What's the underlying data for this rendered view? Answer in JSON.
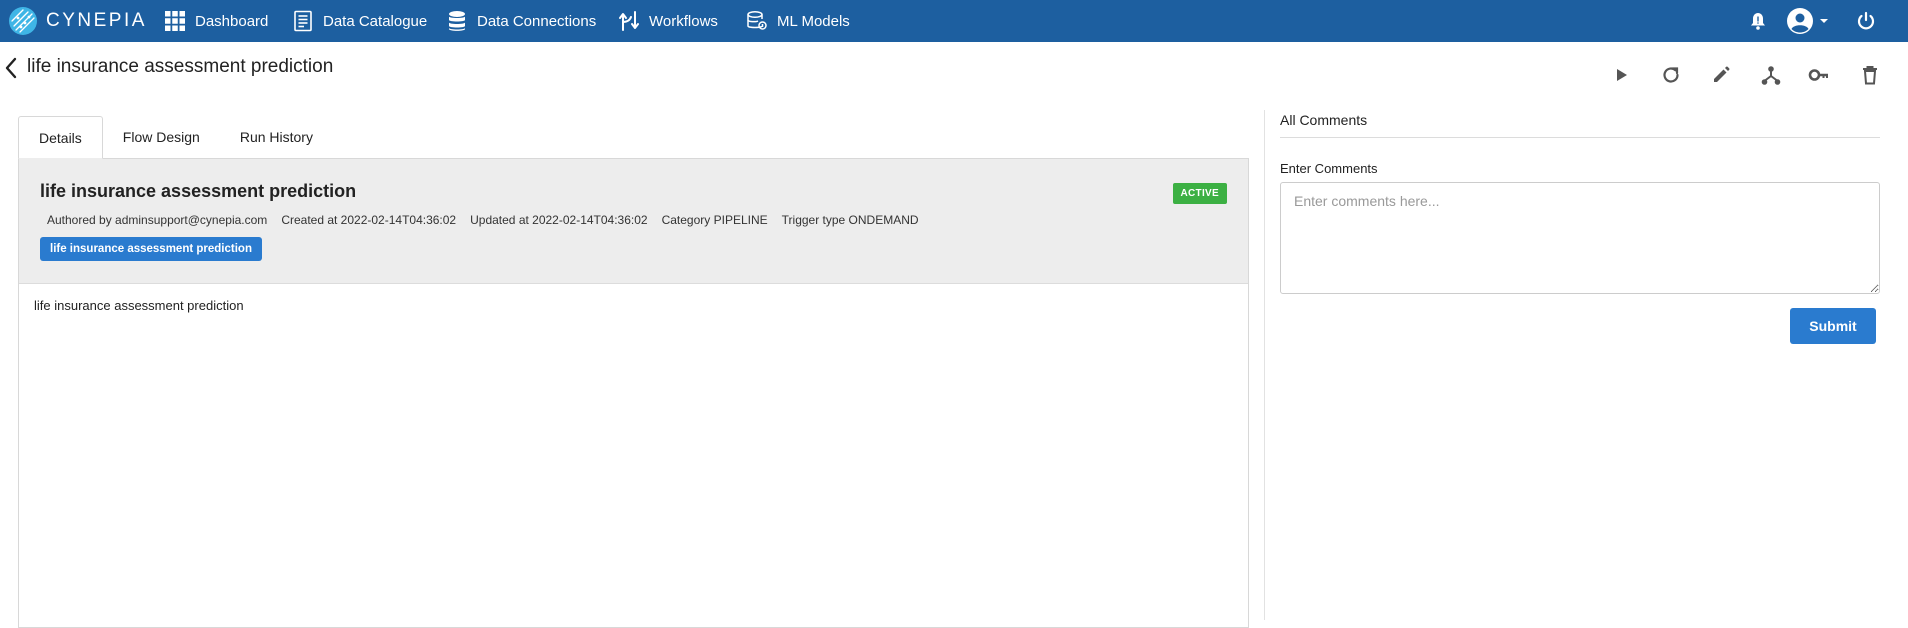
{
  "brand": {
    "name": "CYNEPIA",
    "logo_icon": "cynepia-logo-icon"
  },
  "nav": {
    "items": [
      {
        "label": "Dashboard",
        "icon": "grid-icon"
      },
      {
        "label": "Data Catalogue",
        "icon": "document-icon"
      },
      {
        "label": "Data Connections",
        "icon": "database-icon"
      },
      {
        "label": "Workflows",
        "icon": "workflow-arrows-icon"
      },
      {
        "label": "ML Models",
        "icon": "ml-database-icon"
      }
    ],
    "right_icons": [
      "bell-icon",
      "user-account-icon",
      "chevron-down-icon",
      "power-icon"
    ]
  },
  "header": {
    "title": "life insurance assessment prediction",
    "actions": [
      "play-icon",
      "refresh-icon",
      "edit-icon",
      "fork-icon",
      "key-icon",
      "delete-icon"
    ]
  },
  "tabs": [
    {
      "label": "Details",
      "active": true
    },
    {
      "label": "Flow Design",
      "active": false
    },
    {
      "label": "Run History",
      "active": false
    }
  ],
  "details": {
    "title": "life insurance assessment prediction",
    "status": "ACTIVE",
    "meta": {
      "author": "Authored by adminsupport@cynepia.com",
      "created": "Created at 2022-02-14T04:36:02",
      "updated": "Updated at 2022-02-14T04:36:02",
      "category": "Category PIPELINE",
      "trigger": "Trigger type ONDEMAND"
    },
    "tag": "life insurance assessment prediction",
    "description": "life insurance assessment prediction"
  },
  "comments": {
    "title": "All Comments",
    "label": "Enter Comments",
    "placeholder": "Enter comments here...",
    "value": "",
    "submit_label": "Submit"
  },
  "colors": {
    "navbar": "#1d5fa0",
    "primary": "#2a7bcf",
    "active_badge": "#3cb043",
    "header_bg": "#ededed"
  }
}
